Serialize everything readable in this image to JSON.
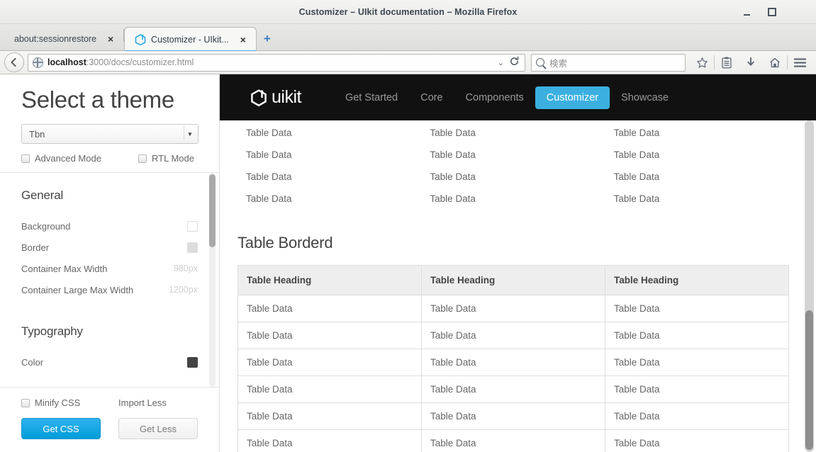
{
  "window": {
    "title": "Customizer – UIkit documentation – Mozilla Firefox",
    "minimize_label": "Minimize",
    "maximize_label": "Maximize",
    "close_label": "×"
  },
  "tabs": [
    {
      "label": "about:sessionrestore",
      "close": "×",
      "active": false
    },
    {
      "label": "Customizer - UIkit...",
      "close": "×",
      "active": true
    }
  ],
  "newtab_label": "+",
  "toolbar": {
    "back_label": "←",
    "url_host": "localhost",
    "url_rest": ":3000/docs/customizer.html",
    "url_full": "localhost:3000/docs/customizer.html",
    "dropdown_label": "⌄",
    "reload_label": "⟳",
    "search_placeholder": "検索",
    "icons": [
      {
        "name": "bookmark-star-icon",
        "label": "☆"
      },
      {
        "name": "library-icon",
        "label": ""
      },
      {
        "name": "downloads-icon",
        "label": "↓"
      },
      {
        "name": "home-icon",
        "label": "⌂"
      },
      {
        "name": "menu-icon",
        "label": "≡"
      }
    ]
  },
  "sidebar": {
    "title": "Select a theme",
    "theme_select": {
      "value": "Tbn",
      "arrow": "▾"
    },
    "modes": [
      {
        "label": "Advanced Mode",
        "checked": false
      },
      {
        "label": "RTL Mode",
        "checked": false
      }
    ],
    "sections": [
      {
        "title": "General",
        "rows": [
          {
            "label": "Background",
            "value": "",
            "swatch": "#ffffff"
          },
          {
            "label": "Border",
            "value": "",
            "swatch": "#dddddd"
          },
          {
            "label": "Container Max Width",
            "value": "980px",
            "swatch": ""
          },
          {
            "label": "Container Large Max Width",
            "value": "1200px",
            "swatch": ""
          }
        ]
      },
      {
        "title": "Typography",
        "rows": [
          {
            "label": "Color",
            "value": "",
            "swatch": "#444444"
          }
        ]
      }
    ],
    "footer": {
      "minify_label": "Minify CSS",
      "minify_checked": false,
      "import_less_label": "Import Less",
      "get_css_label": "Get CSS",
      "get_less_label": "Get Less"
    }
  },
  "site": {
    "brand": "uikit",
    "nav": [
      {
        "label": "Get Started",
        "active": false
      },
      {
        "label": "Core",
        "active": false
      },
      {
        "label": "Components",
        "active": false
      },
      {
        "label": "Customizer",
        "active": true
      },
      {
        "label": "Showcase",
        "active": false
      }
    ],
    "accent_color": "#3bb0e0",
    "navbar_bg": "#111111"
  },
  "doc": {
    "plain_table": {
      "rows": [
        [
          "Table Data",
          "Table Data",
          "Table Data"
        ],
        [
          "Table Data",
          "Table Data",
          "Table Data"
        ],
        [
          "Table Data",
          "Table Data",
          "Table Data"
        ],
        [
          "Table Data",
          "Table Data",
          "Table Data"
        ]
      ]
    },
    "section_heading": "Table Borderd",
    "bordered_table": {
      "headers": [
        "Table Heading",
        "Table Heading",
        "Table Heading"
      ],
      "rows": [
        [
          "Table Data",
          "Table Data",
          "Table Data"
        ],
        [
          "Table Data",
          "Table Data",
          "Table Data"
        ],
        [
          "Table Data",
          "Table Data",
          "Table Data"
        ],
        [
          "Table Data",
          "Table Data",
          "Table Data"
        ],
        [
          "Table Data",
          "Table Data",
          "Table Data"
        ],
        [
          "Table Data",
          "Table Data",
          "Table Data"
        ]
      ]
    }
  }
}
